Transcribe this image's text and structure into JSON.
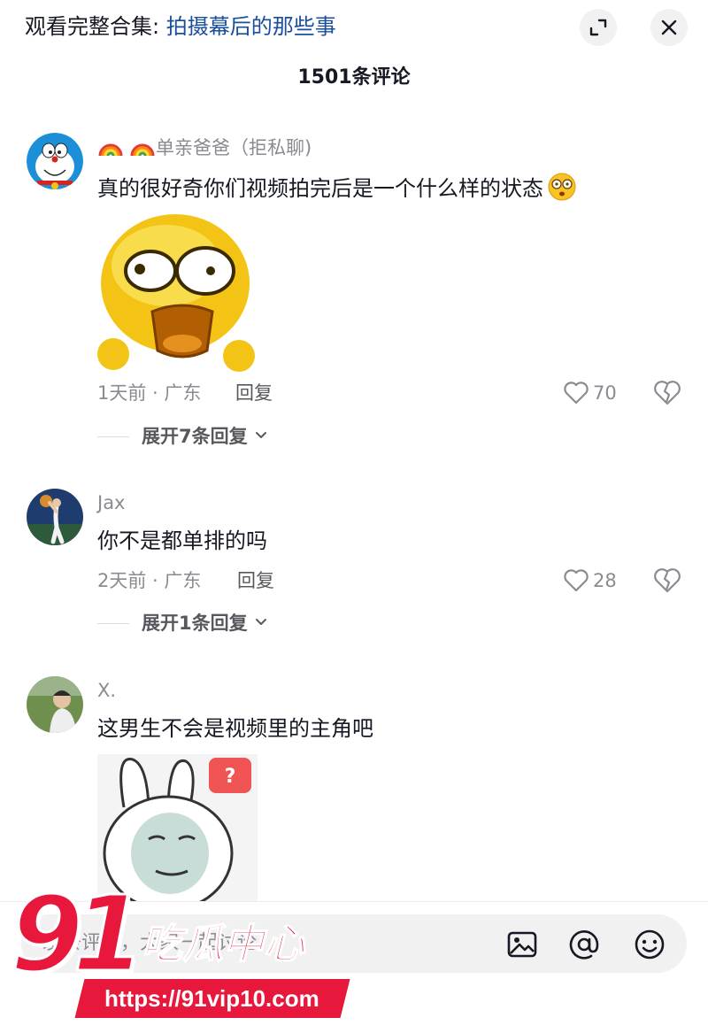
{
  "header": {
    "collection_prefix": "观看完整合集: ",
    "collection_title": "拍摄幕后的那些事",
    "comment_count": "1501条评论"
  },
  "comments": [
    {
      "username": "单亲爸爸（拒私聊)",
      "text": "真的很好奇你们视频拍完后是一个什么样的状态",
      "meta": "1天前 · 广东",
      "reply_label": "回复",
      "likes": "70",
      "expand_label": "展开7条回复"
    },
    {
      "username": "Jax",
      "text": "你不是都单排的吗",
      "meta": "2天前 · 广东",
      "reply_label": "回复",
      "likes": "28",
      "expand_label": "展开1条回复"
    },
    {
      "username": "X.",
      "text": "这男生不会是视频里的主角吧"
    }
  ],
  "input": {
    "placeholder": "发条评论，大家一起讨论"
  },
  "watermark": {
    "number": "91",
    "brand": "吃瓜中心",
    "url": "https://91vip10.com"
  },
  "colors": {
    "link": "#1a4f9c",
    "muted": "#8a8b91",
    "watermark_red": "#e8173c"
  }
}
